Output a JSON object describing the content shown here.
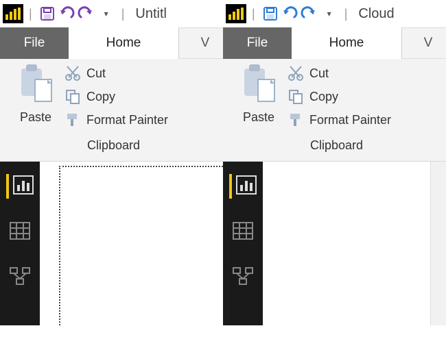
{
  "panes": [
    {
      "accent": "#7B3FB3",
      "doc_title": "Untitl",
      "tabs": {
        "file": "File",
        "home": "Home",
        "next": "V"
      },
      "clipboard": {
        "paste": "Paste",
        "cut": "Cut",
        "copy": "Copy",
        "fp": "Format Painter",
        "group": "Clipboard"
      },
      "show_dotted": true
    },
    {
      "accent": "#2E7CD6",
      "doc_title": "Cloud",
      "tabs": {
        "file": "File",
        "home": "Home",
        "next": "V"
      },
      "clipboard": {
        "paste": "Paste",
        "cut": "Cut",
        "copy": "Copy",
        "fp": "Format Painter",
        "group": "Clipboard"
      },
      "show_dotted": false
    }
  ],
  "icons": {
    "app": "app-logo-icon",
    "save": "save-icon",
    "undo": "undo-icon",
    "redo": "redo-icon",
    "caret": "dropdown-caret-icon",
    "paste": "paste-icon",
    "cut": "cut-icon",
    "copy": "copy-icon",
    "fp": "format-painter-icon",
    "report": "report-view-icon",
    "data": "data-view-icon",
    "model": "model-view-icon"
  }
}
